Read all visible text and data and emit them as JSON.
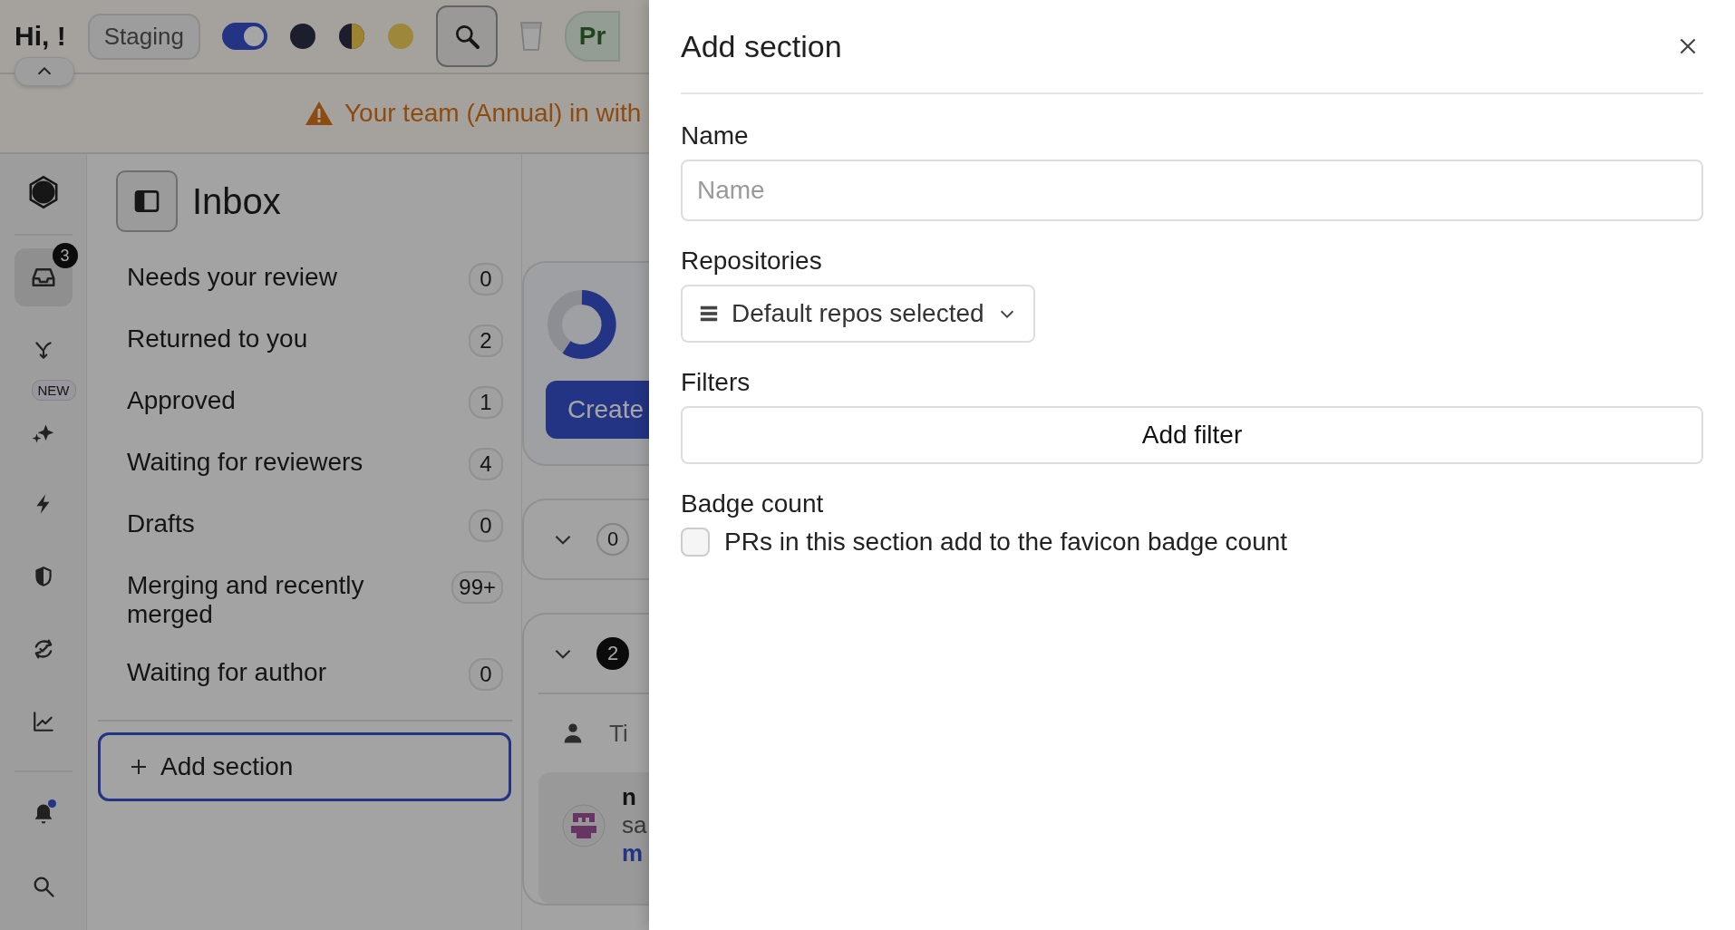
{
  "top_bar": {
    "greeting": "Hi, !",
    "environment": "Staging",
    "toggle_on": true,
    "plan_chip": "Pr"
  },
  "banner": {
    "text": "Your team (Annual) in with"
  },
  "rail": {
    "items": [
      {
        "kind": "inbox",
        "selected": true,
        "badge": "3"
      },
      {
        "kind": "merge",
        "selected": false
      },
      {
        "kind": "sparkles",
        "selected": false,
        "tag": "NEW"
      },
      {
        "kind": "bolt",
        "selected": false
      },
      {
        "kind": "shield",
        "selected": false
      },
      {
        "kind": "sync",
        "selected": false
      },
      {
        "kind": "chart",
        "selected": false
      },
      {
        "kind": "bell",
        "selected": false,
        "dot": true
      },
      {
        "kind": "search",
        "selected": false
      }
    ]
  },
  "inbox": {
    "title": "Inbox",
    "sections": [
      {
        "label": "Needs your review",
        "count": "0"
      },
      {
        "label": "Returned to you",
        "count": "2"
      },
      {
        "label": "Approved",
        "count": "1"
      },
      {
        "label": "Waiting for reviewers",
        "count": "4"
      },
      {
        "label": "Drafts",
        "count": "0"
      },
      {
        "label": "Merging and recently merged",
        "count": "99+"
      },
      {
        "label": "Waiting for author",
        "count": "0"
      }
    ],
    "add_button": "Add section"
  },
  "content": {
    "create_button": "Create",
    "groups": [
      {
        "count": "0",
        "filled": false
      },
      {
        "count": "2",
        "filled": true
      }
    ],
    "column_header": "Ti",
    "pr_lines": [
      "n",
      "sa",
      "m"
    ]
  },
  "drawer": {
    "title": "Add section",
    "name": {
      "label": "Name",
      "placeholder": "Name"
    },
    "repositories": {
      "label": "Repositories",
      "value": "Default repos selected"
    },
    "filters": {
      "label": "Filters",
      "button": "Add filter"
    },
    "badge_count": {
      "label": "Badge count",
      "option": "PRs in this section add to the favicon badge count",
      "checked": false
    }
  }
}
